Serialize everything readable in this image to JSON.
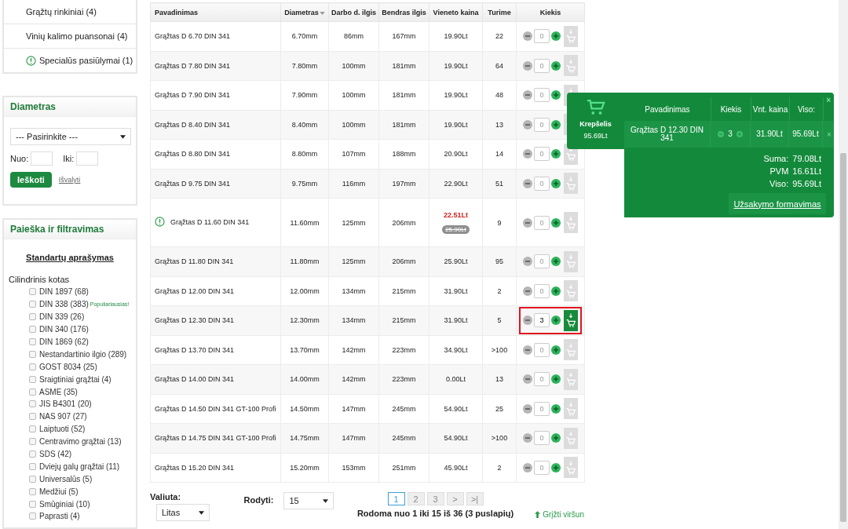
{
  "categories": [
    {
      "label": "Grąžtų rinkiniai (4)",
      "kind": "regular"
    },
    {
      "label": "Vinių kalimo puansonai (4)",
      "kind": "regular"
    },
    {
      "label": "Specialūs pasiūlymai (1)",
      "kind": "special"
    }
  ],
  "diameter_filter": {
    "title": "Diametras",
    "select": "--- Pasirinkite ---",
    "from_label": "Nuo:",
    "to_label": "Iki:",
    "search_button": "Ieškoti",
    "clear_link": "Išvalyti"
  },
  "search_filter": {
    "title": "Paieška ir filtravimas",
    "link": "Standartų aprašymas",
    "group": "Cilindrinis kotas",
    "options": [
      {
        "label": "DIN 1897 (68)",
        "checked": false
      },
      {
        "label": "DIN 338 (383)",
        "checked": false,
        "badge": "Populiariausias!"
      },
      {
        "label": "DIN 339 (26)",
        "checked": false
      },
      {
        "label": "DIN 340 (176)",
        "checked": false
      },
      {
        "label": "DIN 1869 (62)",
        "checked": false
      },
      {
        "label": "Nestandartinio ilgio (289)",
        "checked": false
      },
      {
        "label": "GOST 8034 (25)",
        "checked": false
      },
      {
        "label": "Sraigtiniai grąžtai (4)",
        "checked": false
      },
      {
        "label": "ASME (35)",
        "checked": false
      },
      {
        "label": "JIS B4301 (20)",
        "checked": false
      },
      {
        "label": "NAS 907 (27)",
        "checked": false
      },
      {
        "label": "Laiptuoti (52)",
        "checked": false
      },
      {
        "label": "Centravimo grąžtai (13)",
        "checked": false
      },
      {
        "label": "SDS (42)",
        "checked": false
      },
      {
        "label": "Dviejų galų grąžtai (11)",
        "checked": false
      },
      {
        "label": "Universalūs (5)",
        "checked": false
      },
      {
        "label": "Medžiui (5)",
        "checked": false
      },
      {
        "label": "Smūginiai (10)",
        "checked": false
      },
      {
        "label": "Paprasti (4)",
        "checked": false
      }
    ]
  },
  "table": {
    "columns": [
      "Pavadinimas",
      "Diametras",
      "Darbo d. ilgis",
      "Bendras ilgis",
      "Vieneto kaina",
      "Turime",
      "Kiekis"
    ],
    "rows": [
      {
        "name": "Grąžtas D 6.70 DIN 341",
        "diameter": "6.70mm",
        "work_length": "86mm",
        "total_length": "167mm",
        "price": "19.90Lt",
        "stock": "22",
        "qty": "0",
        "kind": "regular",
        "selected": false
      },
      {
        "name": "Grąžtas D 7.80 DIN 341",
        "diameter": "7.80mm",
        "work_length": "100mm",
        "total_length": "181mm",
        "price": "19.90Lt",
        "stock": "64",
        "qty": "0",
        "kind": "regular",
        "selected": false
      },
      {
        "name": "Grąžtas D 7.90 DIN 341",
        "diameter": "7.90mm",
        "work_length": "100mm",
        "total_length": "181mm",
        "price": "19.90Lt",
        "stock": "48",
        "qty": "0",
        "kind": "regular",
        "selected": false
      },
      {
        "name": "Grąžtas D 8.40 DIN 341",
        "diameter": "8.40mm",
        "work_length": "100mm",
        "total_length": "181mm",
        "price": "19.90Lt",
        "stock": "13",
        "qty": "0",
        "kind": "regular",
        "selected": false
      },
      {
        "name": "Grąžtas D 8.80 DIN 341",
        "diameter": "8.80mm",
        "work_length": "107mm",
        "total_length": "188mm",
        "price": "20.90Lt",
        "stock": "14",
        "qty": "0",
        "kind": "regular",
        "selected": false
      },
      {
        "name": "Grąžtas D 9.75 DIN 341",
        "diameter": "9.75mm",
        "work_length": "116mm",
        "total_length": "197mm",
        "price": "22.90Lt",
        "stock": "51",
        "qty": "0",
        "kind": "regular",
        "selected": false
      },
      {
        "name": "Grąžtas D 11.60 DIN 341",
        "diameter": "11.60mm",
        "work_length": "125mm",
        "total_length": "206mm",
        "price": "22.51Lt",
        "old_price": "25.90Lt",
        "stock": "9",
        "qty": "0",
        "kind": "special",
        "selected": false
      },
      {
        "name": "Grąžtas D 11.80 DIN 341",
        "diameter": "11.80mm",
        "work_length": "125mm",
        "total_length": "206mm",
        "price": "25.90Lt",
        "stock": "95",
        "qty": "0",
        "kind": "regular",
        "selected": false
      },
      {
        "name": "Grąžtas D 12.00 DIN 341",
        "diameter": "12.00mm",
        "work_length": "134mm",
        "total_length": "215mm",
        "price": "31.90Lt",
        "stock": "2",
        "qty": "0",
        "kind": "regular",
        "selected": false
      },
      {
        "name": "Grąžtas D 12.30 DIN 341",
        "diameter": "12.30mm",
        "work_length": "134mm",
        "total_length": "215mm",
        "price": "31.90Lt",
        "stock": "5",
        "qty": "3",
        "kind": "regular",
        "selected": true
      },
      {
        "name": "Grąžtas D 13.70 DIN 341",
        "diameter": "13.70mm",
        "work_length": "142mm",
        "total_length": "223mm",
        "price": "34.90Lt",
        "stock": ">100",
        "qty": "0",
        "kind": "regular",
        "selected": false
      },
      {
        "name": "Grąžtas D 14.00 DIN 341",
        "diameter": "14.00mm",
        "work_length": "142mm",
        "total_length": "223mm",
        "price": "0.00Lt",
        "stock": "13",
        "qty": "0",
        "kind": "regular",
        "selected": false
      },
      {
        "name": "Grąžtas D 14.50 DIN 341 GT-100 Profi",
        "diameter": "14.50mm",
        "work_length": "147mm",
        "total_length": "245mm",
        "price": "54.90Lt",
        "stock": "25",
        "qty": "0",
        "kind": "regular",
        "selected": false
      },
      {
        "name": "Grąžtas D 14.75 DIN 341 GT-100 Profi",
        "diameter": "14.75mm",
        "work_length": "147mm",
        "total_length": "245mm",
        "price": "54.90Lt",
        "stock": ">100",
        "qty": "0",
        "kind": "regular",
        "selected": false
      },
      {
        "name": "Grąžtas D 15.20 DIN 341",
        "diameter": "15.20mm",
        "work_length": "153mm",
        "total_length": "251mm",
        "price": "45.90Lt",
        "stock": "2",
        "qty": "0",
        "kind": "regular",
        "selected": false
      }
    ]
  },
  "footer": {
    "currency_label": "Valiuta:",
    "currency": "Litas",
    "show_label": "Rodyti:",
    "show": "15",
    "pages": [
      {
        "label": "1",
        "selected": true
      },
      {
        "label": "2",
        "selected": false
      },
      {
        "label": "3",
        "selected": false
      },
      {
        "label": ">",
        "selected": false
      },
      {
        "label": ">|",
        "selected": false
      }
    ],
    "info": "Rodoma nuo 1 iki 15 iš 36 (3 puslapių)",
    "back_to_top": "Grįžti viršun"
  },
  "cart": {
    "title": "Krepšelis",
    "total": "95.69Lt",
    "columns": [
      "Pavadinimas",
      "Kiekis",
      "Vnt. kaina",
      "Viso:"
    ],
    "close": "×",
    "items": [
      {
        "name": "Grąžtas D 12.30 DIN 341",
        "qty": "3",
        "price": "31.90Lt",
        "total": "95.69Lt",
        "remove": "×"
      }
    ],
    "summary": [
      {
        "label": "Suma:",
        "value": "79.08Lt"
      },
      {
        "label": "PVM",
        "value": "16.61Lt"
      },
      {
        "label": "Viso:",
        "value": "95.69Lt"
      }
    ],
    "order_link": "Užsakymo formavimas"
  }
}
